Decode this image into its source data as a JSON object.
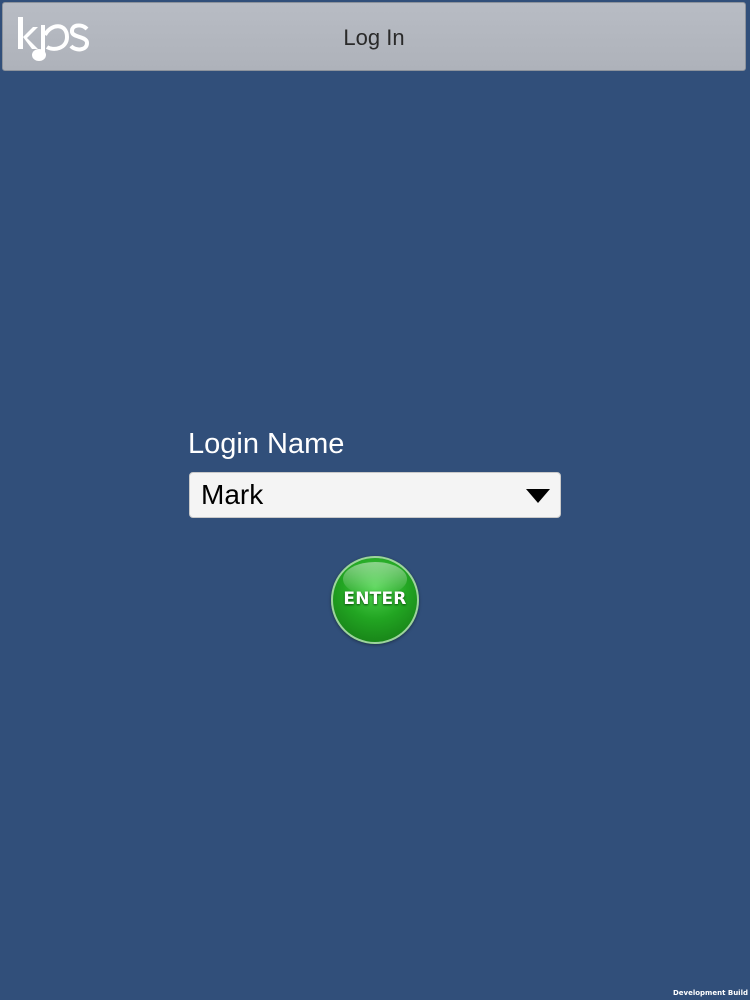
{
  "header": {
    "title": "Log In",
    "logo_icon": "kds-logo-icon"
  },
  "login": {
    "label": "Login Name",
    "selected_value": "Mark",
    "arrow_icon": "dropdown-arrow-icon"
  },
  "enter_button": {
    "label": "ENTER"
  },
  "footer": {
    "build_label": "Development Build"
  },
  "colors": {
    "background": "#314f7a",
    "header": "#b3b7bf",
    "enter_green": "#22a522"
  }
}
